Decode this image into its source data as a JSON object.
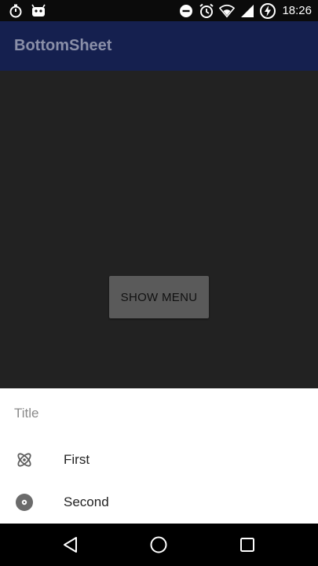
{
  "status_bar": {
    "time": "18:26",
    "left_icons": [
      "stopwatch-icon",
      "android-icon"
    ],
    "right_icons": [
      "do-not-disturb-icon",
      "alarm-icon",
      "wifi-icon",
      "signal-icon",
      "battery-charging-icon"
    ]
  },
  "app_bar": {
    "title": "BottomSheet"
  },
  "main": {
    "button_label": "SHOW MENU"
  },
  "bottom_sheet": {
    "title": "Title",
    "items": [
      {
        "label": "First",
        "icon": "atom-icon"
      },
      {
        "label": "Second",
        "icon": "disc-icon"
      }
    ]
  },
  "nav_bar": {
    "buttons": [
      "back-icon",
      "home-icon",
      "recents-icon"
    ]
  },
  "colors": {
    "app_bar": "#15204f",
    "scrim_content": "#222222",
    "sheet_background": "#ffffff"
  }
}
